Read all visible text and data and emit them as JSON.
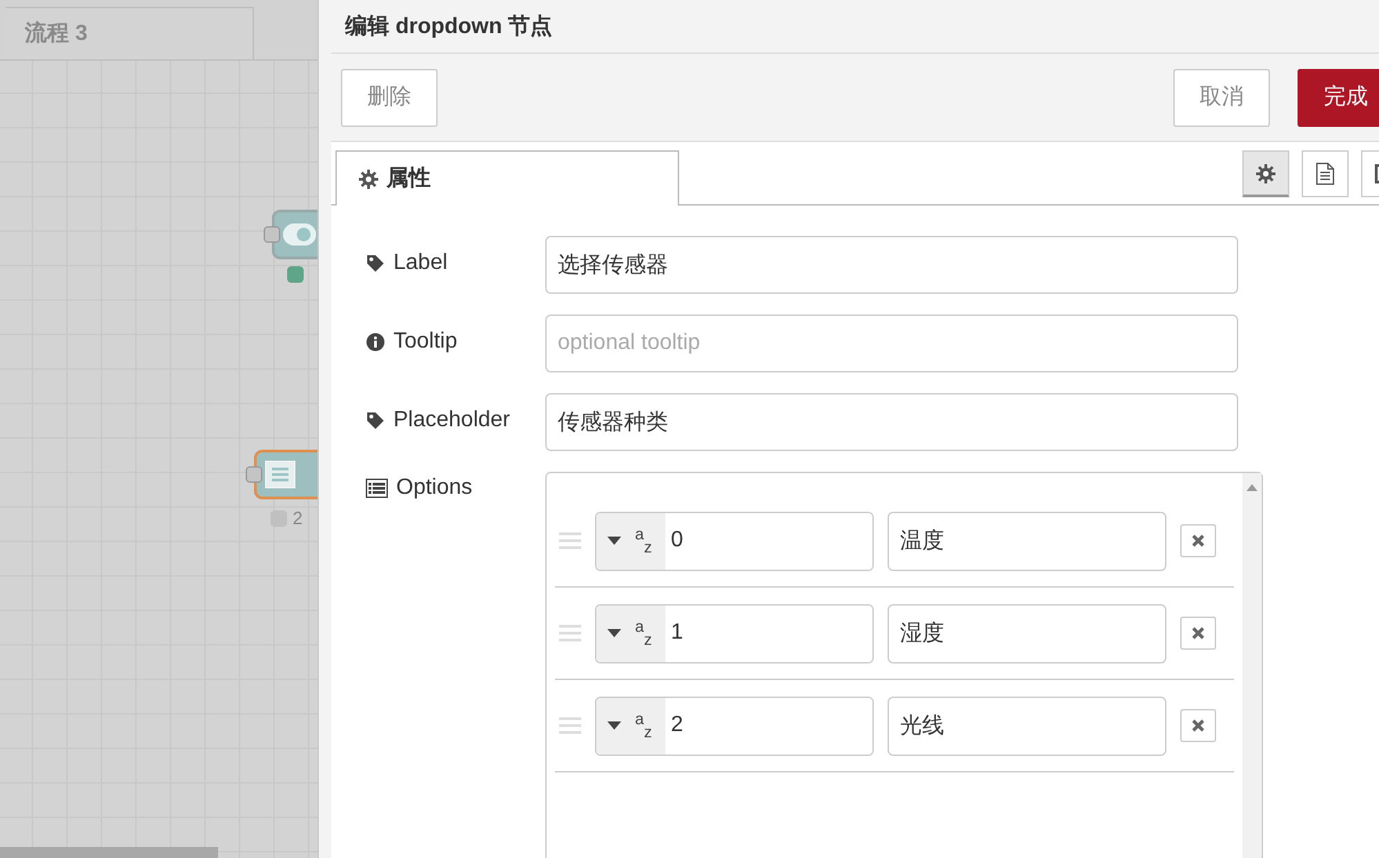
{
  "workspace": {
    "tab": {
      "label": "流程 3",
      "selected": true
    },
    "nodes": [
      {
        "kind": "toggle",
        "selected": false,
        "color": "#5fa58a"
      },
      {
        "kind": "list",
        "selected": true,
        "color": "#c0c0c0",
        "status": "2"
      }
    ]
  },
  "dialog": {
    "title": "编辑 dropdown 节点",
    "buttons": [
      {
        "label": "删除",
        "kind": "plain"
      },
      {
        "label": "取消",
        "kind": "plain"
      },
      {
        "label": "完成",
        "kind": "primary"
      }
    ],
    "tabs": [
      {
        "label": "属性",
        "selected": true
      }
    ],
    "side_tabs": [
      {
        "kind": "settings",
        "selected": true
      },
      {
        "kind": "description",
        "selected": false
      },
      {
        "kind": "appearance",
        "selected": false
      }
    ],
    "fields": [
      {
        "kind": "label",
        "label": "Label",
        "value": "选择传感器"
      },
      {
        "kind": "tooltip",
        "label": "Tooltip",
        "placeholder": "optional tooltip"
      },
      {
        "kind": "placeholder",
        "label": "Placeholder",
        "value": "传感器种类"
      }
    ],
    "options": {
      "label": "Options",
      "items": [
        {
          "type": "$^{a}$$_{z}$",
          "value": "0",
          "label": "温度"
        },
        {
          "type": "$^{a}$$_{z}$",
          "value": "1",
          "label": "湿度"
        },
        {
          "type": "$^{a}$$_{z}$",
          "value": "2",
          "label": "光线"
        }
      ]
    }
  }
}
